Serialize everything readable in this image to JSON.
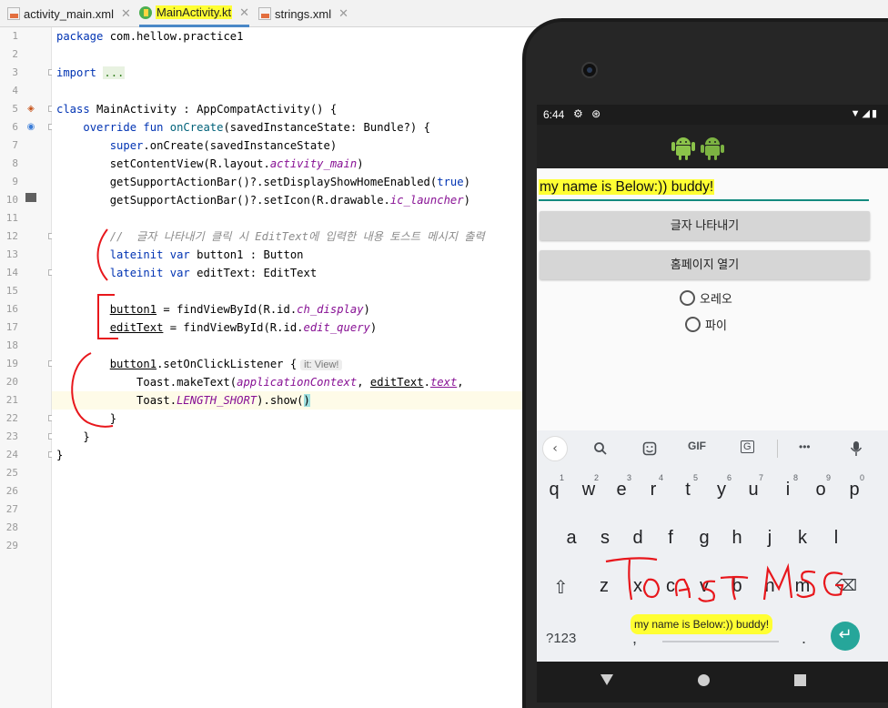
{
  "editor": {
    "tabs": [
      {
        "label": "activity_main.xml",
        "close": "✕"
      },
      {
        "label": "MainActivity.kt",
        "close": "✕"
      },
      {
        "label": "strings.xml",
        "close": "✕"
      }
    ],
    "line_numbers": [
      "1",
      "2",
      "3",
      "4",
      "5",
      "6",
      "7",
      "8",
      "9",
      "10",
      "11",
      "12",
      "13",
      "14",
      "15",
      "16",
      "17",
      "18",
      "19",
      "20",
      "21",
      "22",
      "23",
      "24",
      "25",
      "26",
      "27",
      "28",
      "29"
    ],
    "code": {
      "l1_kw": "package",
      "l1_rest": " com.hellow.practice1",
      "l3_kw": "import",
      "l3_fold": "...",
      "l5_kw": "class",
      "l5_rest": " MainActivity : AppCompatActivity() {",
      "l6_indent": "    ",
      "l6_kw": "override fun",
      "l6_fn": " onCreate",
      "l6_rest": "(savedInstanceState: Bundle?) {",
      "l7_indent": "        ",
      "l7_kw": "super",
      "l7_rest": ".onCreate(savedInstanceState)",
      "l8_pre": "        setContentView(R.layout.",
      "l8_it": "activity_main",
      "l8_post": ")",
      "l9_pre": "        getSupportActionBar()?.setDisplayShowHomeEnabled(",
      "l9_kw": "true",
      "l9_post": ")",
      "l10_pre": "        getSupportActionBar()?.setIcon(R.drawable.",
      "l10_it": "ic_launcher",
      "l10_post": ")",
      "l12_comment": "        //  글자 나타내기 클릭 시 EditText에 입력한 내용 토스트 메시지 출력",
      "l13_indent": "        ",
      "l13_kw": "lateinit var",
      "l13_rest": " button1 : Button",
      "l14_indent": "        ",
      "l14_kw": "lateinit var",
      "l14_rest": " editText: EditText",
      "l16_indent": "        ",
      "l16_var": "button1",
      "l16_pre": " = findViewById(R.id.",
      "l16_it": "ch_display",
      "l16_post": ")",
      "l17_indent": "        ",
      "l17_var": "editText",
      "l17_pre": " = findViewById(R.id.",
      "l17_it": "edit_query",
      "l17_post": ")",
      "l19_indent": "        ",
      "l19_var": "button1",
      "l19_rest": ".setOnClickListener {",
      "l19_hint": "it: View!",
      "l20_pre": "            Toast.makeText(",
      "l20_it": "applicationContext",
      "l20_mid": ", ",
      "l20_var": "editText",
      "l20_dot": ".",
      "l20_it2": "text",
      "l20_post": ",",
      "l21_pre": "            Toast.",
      "l21_it": "LENGTH_SHORT",
      "l21_mid": ").show(",
      "l21_paren": ")",
      "l22": "        }",
      "l23": "    }",
      "l24": "}"
    }
  },
  "device": {
    "status": {
      "time": "6:44",
      "left_icons": "⚙ ⊛",
      "right_icons": "▼◢▮"
    },
    "edit_text": "my name is Below:)) buddy!",
    "button_show_text": "글자 나타내기",
    "button_homepage": "홈페이지 열기",
    "radio_options": [
      "오레오",
      "파이"
    ],
    "keyboard": {
      "toolbar_icons": [
        "back-chevron",
        "search",
        "sticker",
        "gif",
        "translate",
        "more",
        "mic"
      ],
      "gif_label": "GIF",
      "translate_label": "G",
      "more_label": "•••",
      "back_label": "‹",
      "row1": [
        "q",
        "w",
        "e",
        "r",
        "t",
        "y",
        "u",
        "i",
        "o",
        "p"
      ],
      "row1_hints": [
        "1",
        "2",
        "3",
        "4",
        "5",
        "6",
        "7",
        "8",
        "9",
        "0"
      ],
      "row2": [
        "a",
        "s",
        "d",
        "f",
        "g",
        "h",
        "j",
        "k",
        "l"
      ],
      "row3": [
        "z",
        "x",
        "c",
        "v",
        "b",
        "n",
        "m"
      ],
      "symbols_label": "?123",
      "comma_label": ",",
      "period_label": ".",
      "enter_label": "↵",
      "shift_label": "⇧",
      "backspace_label": "⌫"
    },
    "toast_message": "my name is Below:)) buddy!"
  },
  "annotation": {
    "handwritten": "Toast MSG",
    "ink_color": "#e8171c"
  },
  "colors": {
    "highlight": "#ffff33",
    "keyword": "#0033b3",
    "italic_member": "#871094",
    "comment": "#8c8c8c",
    "accent_teal": "#26a69a"
  }
}
